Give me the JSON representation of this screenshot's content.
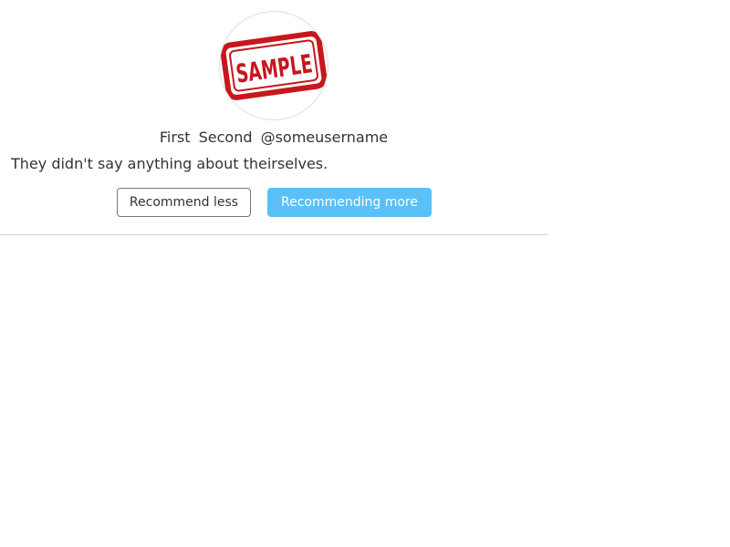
{
  "profile": {
    "avatar_text": "SAMPLE",
    "first_name": "First",
    "last_name": "Second",
    "username": "@someusername",
    "bio": "They didn't say anything about theirselves."
  },
  "actions": {
    "recommend_less_label": "Recommend less",
    "recommend_more_label": "Recommending more"
  },
  "colors": {
    "stamp_red": "#c8161d",
    "more_button_bg": "#5bc0f8",
    "divider": "#cfcfcf"
  }
}
